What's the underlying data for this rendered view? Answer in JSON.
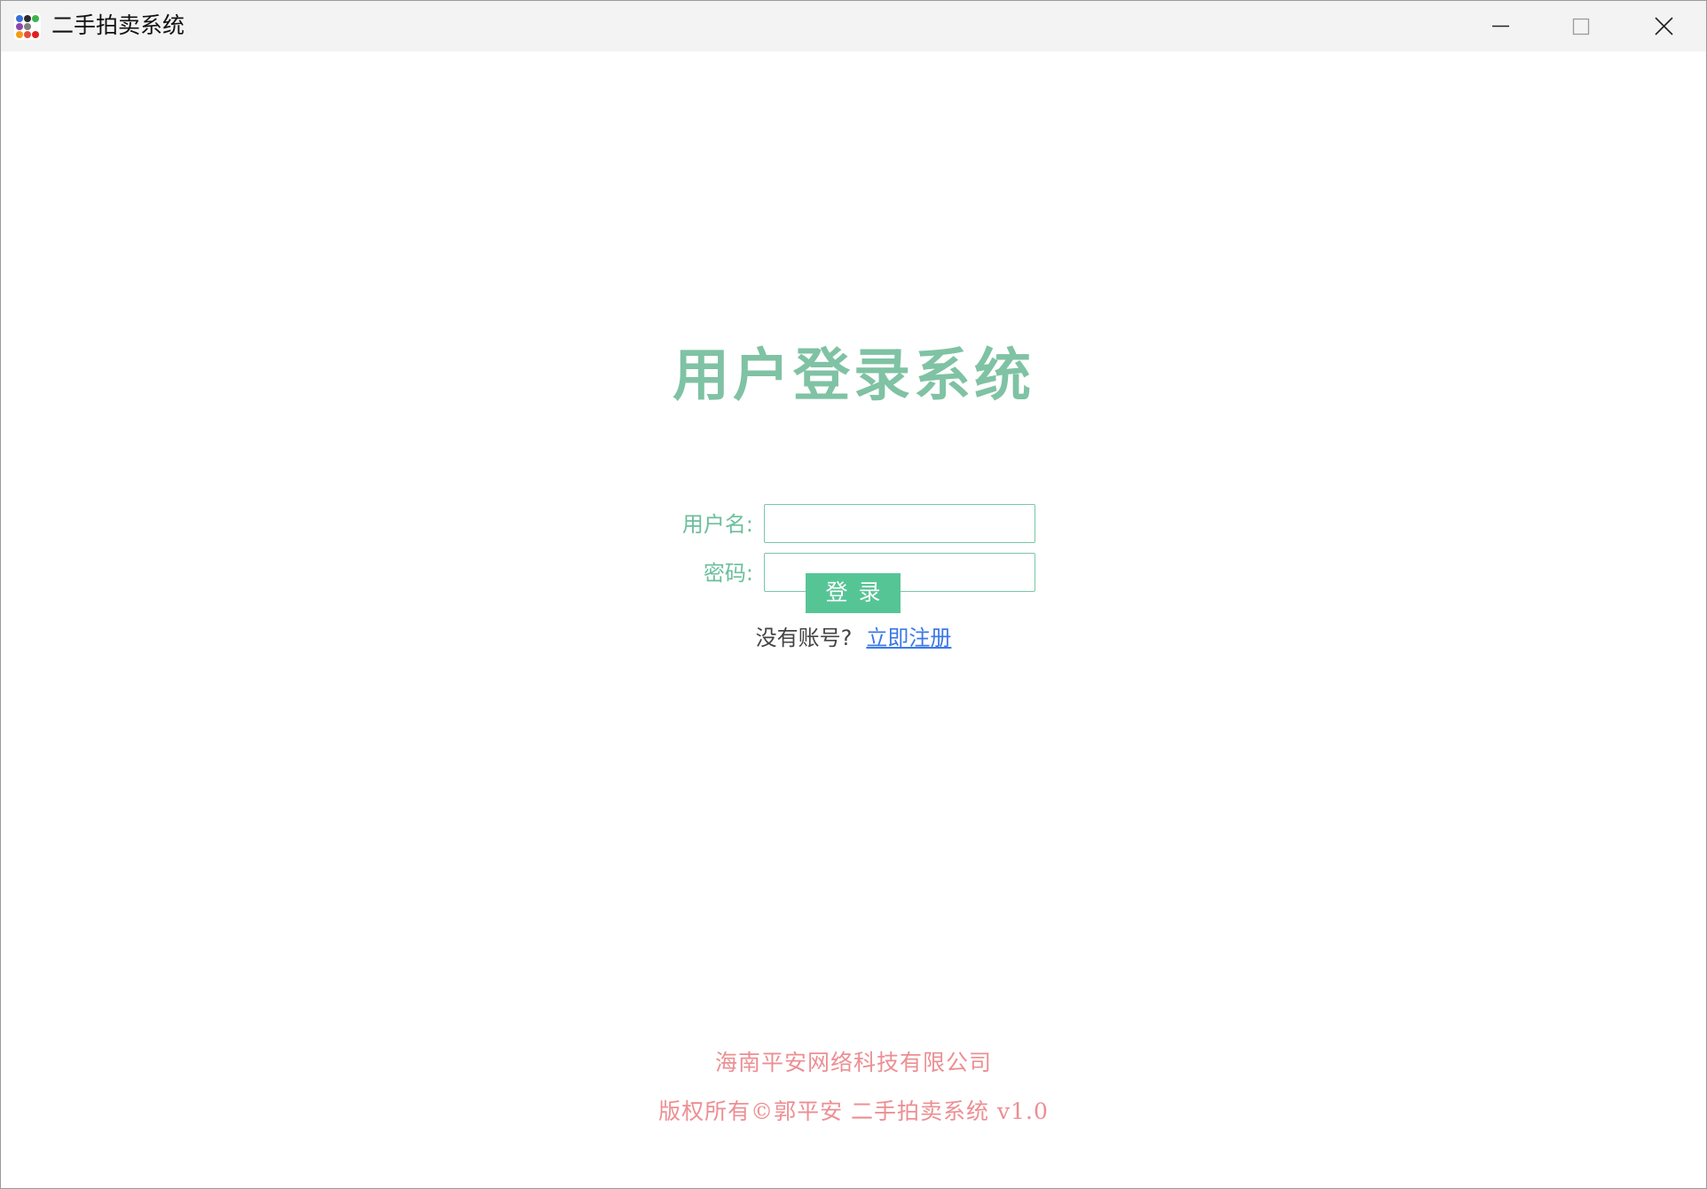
{
  "window": {
    "title": "二手拍卖系统",
    "app_icon": "app-grid-icon",
    "controls": [
      "minimize-icon",
      "maximize-icon",
      "close-icon"
    ]
  },
  "login": {
    "heading": "用户登录系统",
    "username_label": "用户名:",
    "username_value": "",
    "password_label": "密码:",
    "password_value": "",
    "login_button": "登录",
    "register_prompt": "没有账号?",
    "register_link": "立即注册"
  },
  "footer": {
    "company": "海南平安网络科技有限公司",
    "copyright": "版权所有©郭平安 二手拍卖系统 v1.0"
  },
  "colors": {
    "accent": "#56c596",
    "heading": "#7fc2a4",
    "label": "#6cbf9c",
    "link": "#3b78e7",
    "footer": "#ec8f93"
  }
}
